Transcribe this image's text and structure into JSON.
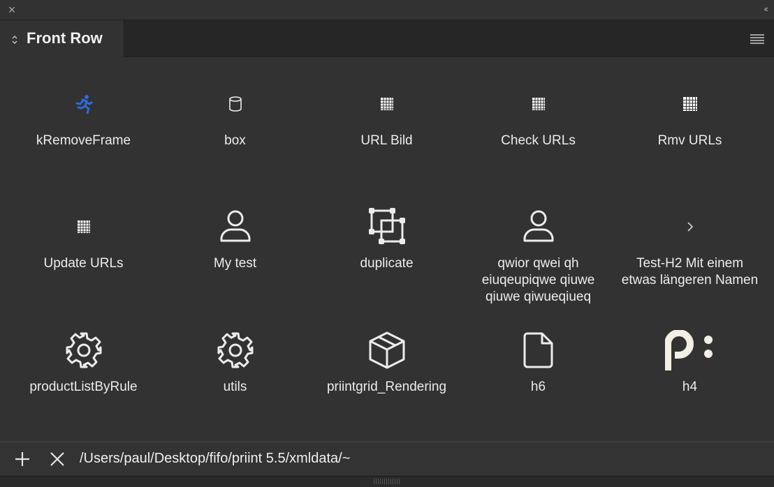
{
  "panel": {
    "title": "Front Row",
    "path": "/Users/paul/Desktop/fifo/priint 5.5/xmldata/~"
  },
  "colors": {
    "accent_run_icon": "#2f6bd8",
    "background": "#323232"
  },
  "items": [
    {
      "label": "kRemoveFrame",
      "icon": "running-person-icon"
    },
    {
      "label": "box",
      "icon": "cylinder-icon"
    },
    {
      "label": "URL Bild",
      "icon": "grid-icon"
    },
    {
      "label": "Check URLs",
      "icon": "grid-icon"
    },
    {
      "label": "Rmv URLs",
      "icon": "grid-icon"
    },
    {
      "label": "Update URLs",
      "icon": "grid-icon"
    },
    {
      "label": "My test",
      "icon": "user-icon"
    },
    {
      "label": "duplicate",
      "icon": "duplicate-frames-icon"
    },
    {
      "label": "qwior qwei qh eiuqeupiqwe qiuwe qiuwe qiwueqiueq",
      "icon": "user-icon"
    },
    {
      "label": "Test-H2 Mit einem etwas längeren Namen",
      "icon": "chevron-right-icon"
    },
    {
      "label": "productListByRule",
      "icon": "gear-icon"
    },
    {
      "label": "utils",
      "icon": "gear-icon"
    },
    {
      "label": "priintgrid_Rendering",
      "icon": "package-icon"
    },
    {
      "label": "h6",
      "icon": "document-icon"
    },
    {
      "label": "h4",
      "icon": "priint-logo-icon"
    }
  ]
}
